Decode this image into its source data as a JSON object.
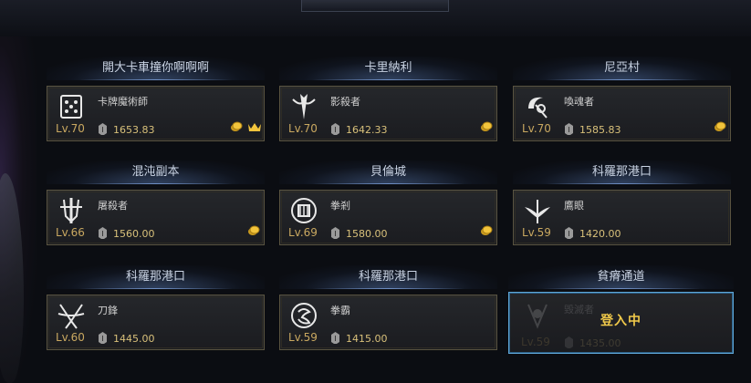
{
  "characters": [
    {
      "server": "開大卡車撞你啊啊啊",
      "class_name": "卡牌魔術師",
      "level": "Lv.70",
      "item_level": "1653.83",
      "coin": true,
      "crown": true,
      "emblem": "card-master-emblem-icon"
    },
    {
      "server": "卡里納利",
      "class_name": "影殺者",
      "level": "Lv.70",
      "item_level": "1642.33",
      "coin": true,
      "crown": false,
      "emblem": "shadowhunter-emblem-icon"
    },
    {
      "server": "尼亞村",
      "class_name": "喚魂者",
      "level": "Lv.70",
      "item_level": "1585.83",
      "coin": true,
      "crown": false,
      "emblem": "reaper-emblem-icon"
    },
    {
      "server": "混沌副本",
      "class_name": "屠殺者",
      "level": "Lv.66",
      "item_level": "1560.00",
      "coin": true,
      "crown": false,
      "emblem": "slayer-emblem-icon"
    },
    {
      "server": "貝倫城",
      "class_name": "拳剎",
      "level": "Lv.69",
      "item_level": "1580.00",
      "coin": true,
      "crown": false,
      "emblem": "striker-emblem-icon"
    },
    {
      "server": "科羅那港口",
      "class_name": "鷹眼",
      "level": "Lv.59",
      "item_level": "1420.00",
      "coin": false,
      "crown": false,
      "emblem": "sharpshooter-emblem-icon"
    },
    {
      "server": "科羅那港口",
      "class_name": "刀鋒",
      "level": "Lv.60",
      "item_level": "1445.00",
      "coin": false,
      "crown": false,
      "emblem": "deathblade-emblem-icon"
    },
    {
      "server": "科羅那港口",
      "class_name": "拳霸",
      "level": "Lv.59",
      "item_level": "1415.00",
      "coin": false,
      "crown": false,
      "emblem": "wardancer-emblem-icon"
    },
    {
      "server": "貧瘠通道",
      "class_name": "毀滅者",
      "level": "Lv.59",
      "item_level": "1435.00",
      "coin": false,
      "crown": false,
      "emblem": "destroyer-emblem-icon",
      "status": "登入中",
      "selected": true
    }
  ],
  "colors": {
    "accent_gold": "#f0c94a",
    "selected_border": "#5fa6d6",
    "card_border": "#5a5440"
  }
}
